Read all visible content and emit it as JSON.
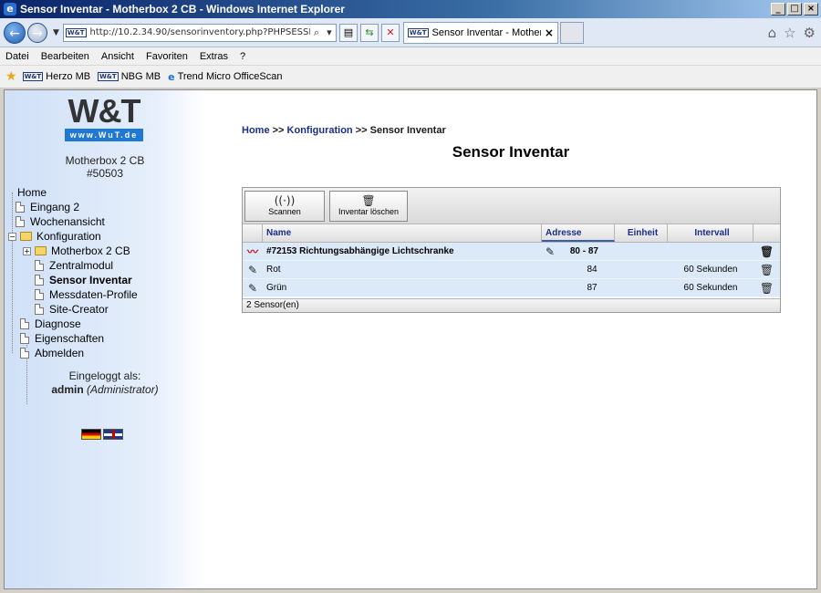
{
  "window": {
    "title": "Sensor Inventar - Motherbox 2 CB - Windows Internet Explorer",
    "controls": [
      "minimize",
      "maximize",
      "close"
    ]
  },
  "navigation": {
    "url": "http://10.2.34.90/sensorinventory.php?PHPSESSID=1d6btl",
    "favicon_text": "W&T",
    "tab_label": "Sensor Inventar - Motherbo...",
    "icons": [
      "back-icon",
      "forward-icon",
      "search-icon",
      "compat-icon",
      "refresh-icon",
      "stop-icon",
      "home-icon",
      "star-icon",
      "gear-icon"
    ]
  },
  "menu": [
    "Datei",
    "Bearbeiten",
    "Ansicht",
    "Favoriten",
    "Extras",
    "?"
  ],
  "favorites": [
    {
      "icon": "W&T",
      "label": "Herzo MB"
    },
    {
      "icon": "W&T",
      "label": "NBG MB"
    },
    {
      "icon": "e",
      "label": "Trend Micro OfficeScan"
    }
  ],
  "sidebar": {
    "logo_text": "W&T",
    "logo_url": "www.WuT.de",
    "device_name": "Motherbox 2 CB",
    "device_number": "#50503",
    "tree": [
      {
        "label": "Home"
      },
      {
        "label": "Eingang 2"
      },
      {
        "label": "Wochenansicht"
      },
      {
        "label": "Konfiguration"
      },
      {
        "label": "Motherbox 2 CB"
      },
      {
        "label": "Zentralmodul"
      },
      {
        "label": "Sensor Inventar"
      },
      {
        "label": "Messdaten-Profile"
      },
      {
        "label": "Site-Creator"
      },
      {
        "label": "Diagnose"
      },
      {
        "label": "Eigenschaften"
      },
      {
        "label": "Abmelden"
      }
    ],
    "login_label": "Eingeloggt als:",
    "login_user": "admin",
    "login_role": "(Administrator)"
  },
  "main": {
    "breadcrumb": {
      "home": "Home",
      "sep1": " >> ",
      "config": "Konfiguration",
      "sep2": " >> ",
      "current": "Sensor Inventar"
    },
    "title": "Sensor Inventar",
    "toolbar": {
      "scan_label": "Scannen",
      "clear_label": "Inventar löschen"
    },
    "columns": {
      "name": "Name",
      "address": "Adresse",
      "unit": "Einheit",
      "interval": "Intervall"
    },
    "rows": [
      {
        "name": "#72153 Richtungsabhängige Lichtschranke",
        "address": "80 - 87",
        "unit": "",
        "interval": ""
      },
      {
        "name": "Rot",
        "address": "84",
        "unit": "",
        "interval": "60 Sekunden"
      },
      {
        "name": "Grün",
        "address": "87",
        "unit": "",
        "interval": "60 Sekunden"
      }
    ],
    "status": "2 Sensor(en)"
  }
}
